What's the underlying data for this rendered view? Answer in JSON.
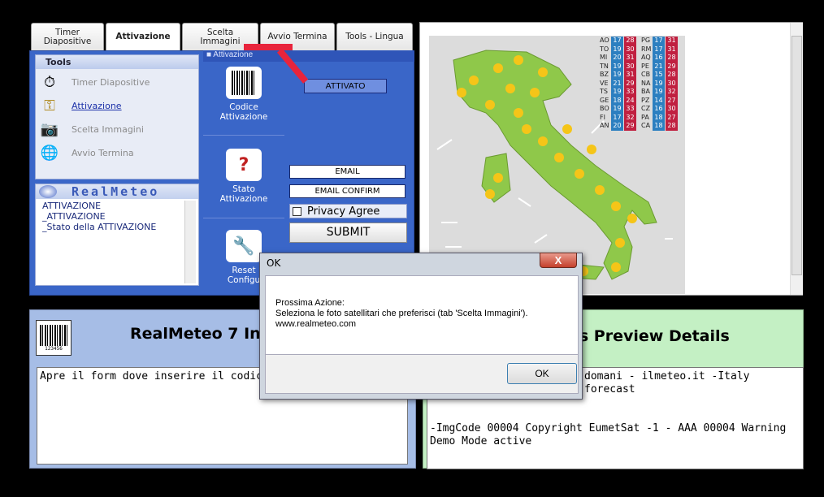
{
  "tabs": [
    {
      "label": "Timer Diapositive"
    },
    {
      "label": "Attivazione"
    },
    {
      "label": "Scelta Immagini"
    },
    {
      "label": "Avvio Termina"
    },
    {
      "label": "Tools - Lingua"
    }
  ],
  "tools": {
    "header": "Tools",
    "items": [
      {
        "label": "Timer Diapositive",
        "icon": "stopwatch-icon"
      },
      {
        "label": "Attivazione",
        "icon": "keys-icon"
      },
      {
        "label": "Scelta Immagini",
        "icon": "camera-icon"
      },
      {
        "label": "Avvio Termina",
        "icon": "globe-icon"
      }
    ]
  },
  "realmeteo": {
    "title": "RealMeteo",
    "lines": [
      "ATTIVAZIONE",
      "_ATTIVAZIONE",
      "_Stato della ATTIVAZIONE"
    ]
  },
  "activation": {
    "section_label": "Attivazione",
    "status_value": "ATTIVATO",
    "codice_label": "Codice\nAttivazione",
    "stato_label": "Stato\nAttivazione",
    "reset_label": "Reset\nConfigu",
    "email_placeholder": "EMAIL",
    "email_confirm_placeholder": "EMAIL CONFIRM",
    "privacy_label": "Privacy Agree",
    "submit_label": "SUBMIT"
  },
  "cities": [
    [
      "AO",
      "17",
      "28",
      "PG",
      "17",
      "31"
    ],
    [
      "TO",
      "19",
      "30",
      "RM",
      "17",
      "31"
    ],
    [
      "MI",
      "20",
      "31",
      "AQ",
      "16",
      "28"
    ],
    [
      "TN",
      "19",
      "30",
      "PE",
      "21",
      "29"
    ],
    [
      "BZ",
      "19",
      "31",
      "CB",
      "15",
      "28"
    ],
    [
      "VE",
      "21",
      "29",
      "NA",
      "19",
      "30"
    ],
    [
      "TS",
      "19",
      "33",
      "BA",
      "19",
      "32"
    ],
    [
      "GE",
      "18",
      "24",
      "PZ",
      "14",
      "27"
    ],
    [
      "BO",
      "19",
      "33",
      "CZ",
      "16",
      "30"
    ],
    [
      "FI",
      "17",
      "32",
      "PA",
      "18",
      "27"
    ],
    [
      "AN",
      "20",
      "29",
      "CA",
      "18",
      "28"
    ]
  ],
  "bottom_left": {
    "title": "RealMeteo 7 In",
    "text": "Apre il form dove inserire il codice di attiv"
  },
  "bottom_right": {
    "title": "es Preview Details",
    "text_line1": "domani - ilmeteo.it -Italy forecast",
    "text_line2": "-ImgCode 00004 Copyright EumetSat -1 - AAA 00004 Warning Demo Mode active"
  },
  "dialog": {
    "title": "OK",
    "close_symbol": "X",
    "line1": "Prossima Azione:",
    "line2": "Seleziona le foto satellitari che preferisci (tab 'Scelta Immagini').",
    "line3": "www.realmeteo.com",
    "ok_label": "OK"
  },
  "barcode_number": "123456"
}
